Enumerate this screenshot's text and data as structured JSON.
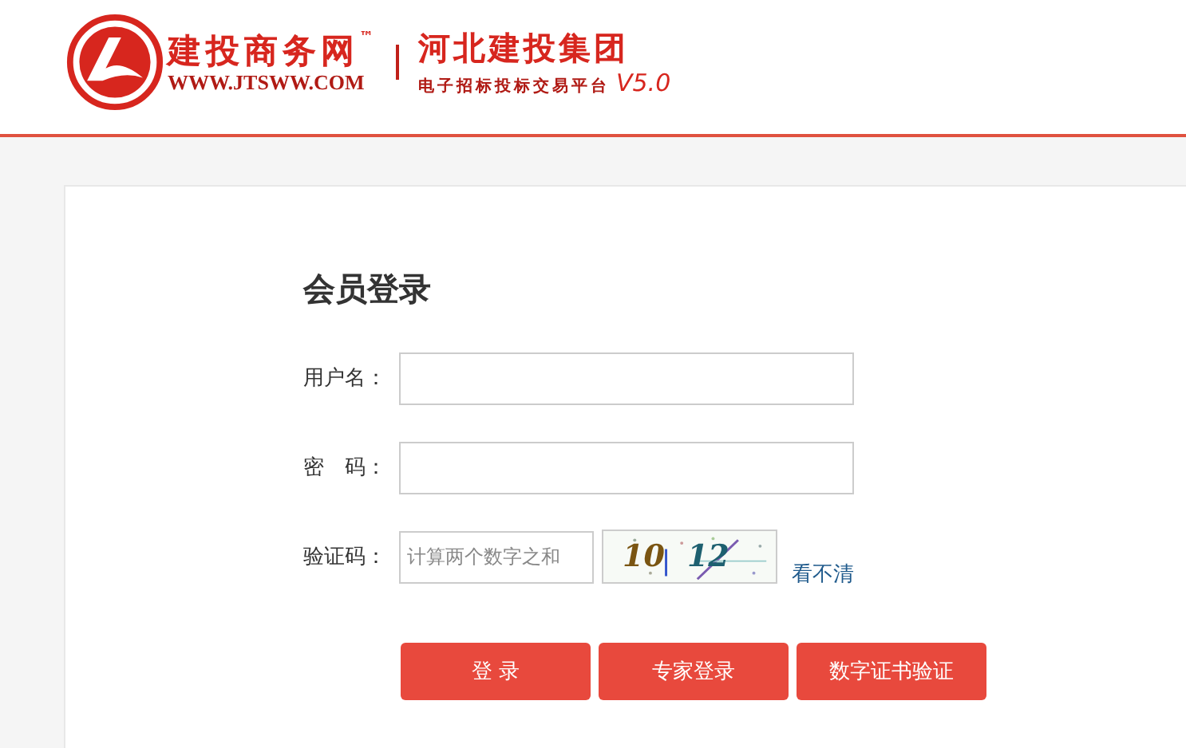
{
  "header": {
    "brand_name": "建投商务网",
    "trademark": "™",
    "brand_url": "WWW.JTSWW.COM",
    "group_name": "河北建投集团",
    "platform_name": "电子招标投标交易平台",
    "version": "V5.0"
  },
  "login": {
    "title": "会员登录",
    "fields": [
      {
        "kind": "text",
        "label": "用户名："
      },
      {
        "kind": "password",
        "label": "密　码："
      },
      {
        "kind": "captcha",
        "label": "验证码：",
        "placeholder": "计算两个数字之和",
        "captcha_parts": [
          "10",
          "12"
        ],
        "refresh_link": "看不清"
      }
    ],
    "buttons": [
      "登 录",
      "专家登录",
      "数字证书验证"
    ]
  }
}
